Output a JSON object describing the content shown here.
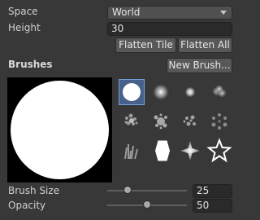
{
  "terrain_settings": {
    "space": {
      "label": "Space",
      "value": "World"
    },
    "height": {
      "label": "Height",
      "value": "30"
    },
    "flatten_tile_label": "Flatten Tile",
    "flatten_all_label": "Flatten All"
  },
  "brushes": {
    "title": "Brushes",
    "new_brush_label": "New Brush...",
    "items": [
      {
        "name": "circle-brush-icon",
        "selected": true
      },
      {
        "name": "soft-blob-brush-icon",
        "selected": false
      },
      {
        "name": "small-soft-brush-icon",
        "selected": false
      },
      {
        "name": "cloud-brush-icon",
        "selected": false
      },
      {
        "name": "noise-brush-icon",
        "selected": false
      },
      {
        "name": "splatter-brush-icon",
        "selected": false
      },
      {
        "name": "scatter-brush-icon",
        "selected": false
      },
      {
        "name": "ring-noise-brush-icon",
        "selected": false
      },
      {
        "name": "grass-brush-icon",
        "selected": false
      },
      {
        "name": "hexagon-brush-icon",
        "selected": false
      },
      {
        "name": "star-burst-brush-icon",
        "selected": false
      },
      {
        "name": "star-outline-brush-icon",
        "selected": false
      }
    ]
  },
  "brush_size": {
    "label": "Brush Size",
    "value": "25",
    "fraction": 0.25
  },
  "opacity": {
    "label": "Opacity",
    "value": "50",
    "fraction": 0.5
  },
  "colors": {
    "background": "#383838",
    "selection": "#47618a",
    "accent": "#79a0db"
  }
}
